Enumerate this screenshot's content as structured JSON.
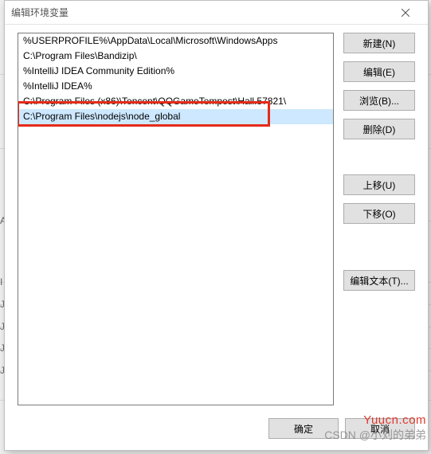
{
  "dialog": {
    "title": "编辑环境变量",
    "close_label": "×"
  },
  "list": {
    "items": [
      "%USERPROFILE%\\AppData\\Local\\Microsoft\\WindowsApps",
      "C:\\Program Files\\Bandizip\\",
      "%IntelliJ IDEA Community Edition%",
      "%IntelliJ IDEA%",
      "C:\\Program Files (x86)\\Tencent\\QQGameTempest\\Hall.57821\\",
      "C:\\Program Files\\nodejs\\node_global"
    ],
    "selected_index": 5,
    "highlight_index": 5
  },
  "buttons": {
    "new": "新建(N)",
    "edit": "编辑(E)",
    "browse": "浏览(B)...",
    "delete": "删除(D)",
    "move_up": "上移(U)",
    "move_down": "下移(O)",
    "edit_text": "编辑文本(T)...",
    "ok": "确定",
    "cancel": "取消"
  },
  "watermarks": {
    "site": "Yuucn.com",
    "author": "CSDN @小刘的弟弟"
  },
  "bg_letters": [
    "A",
    "I",
    "J",
    "J",
    "J",
    "J"
  ]
}
